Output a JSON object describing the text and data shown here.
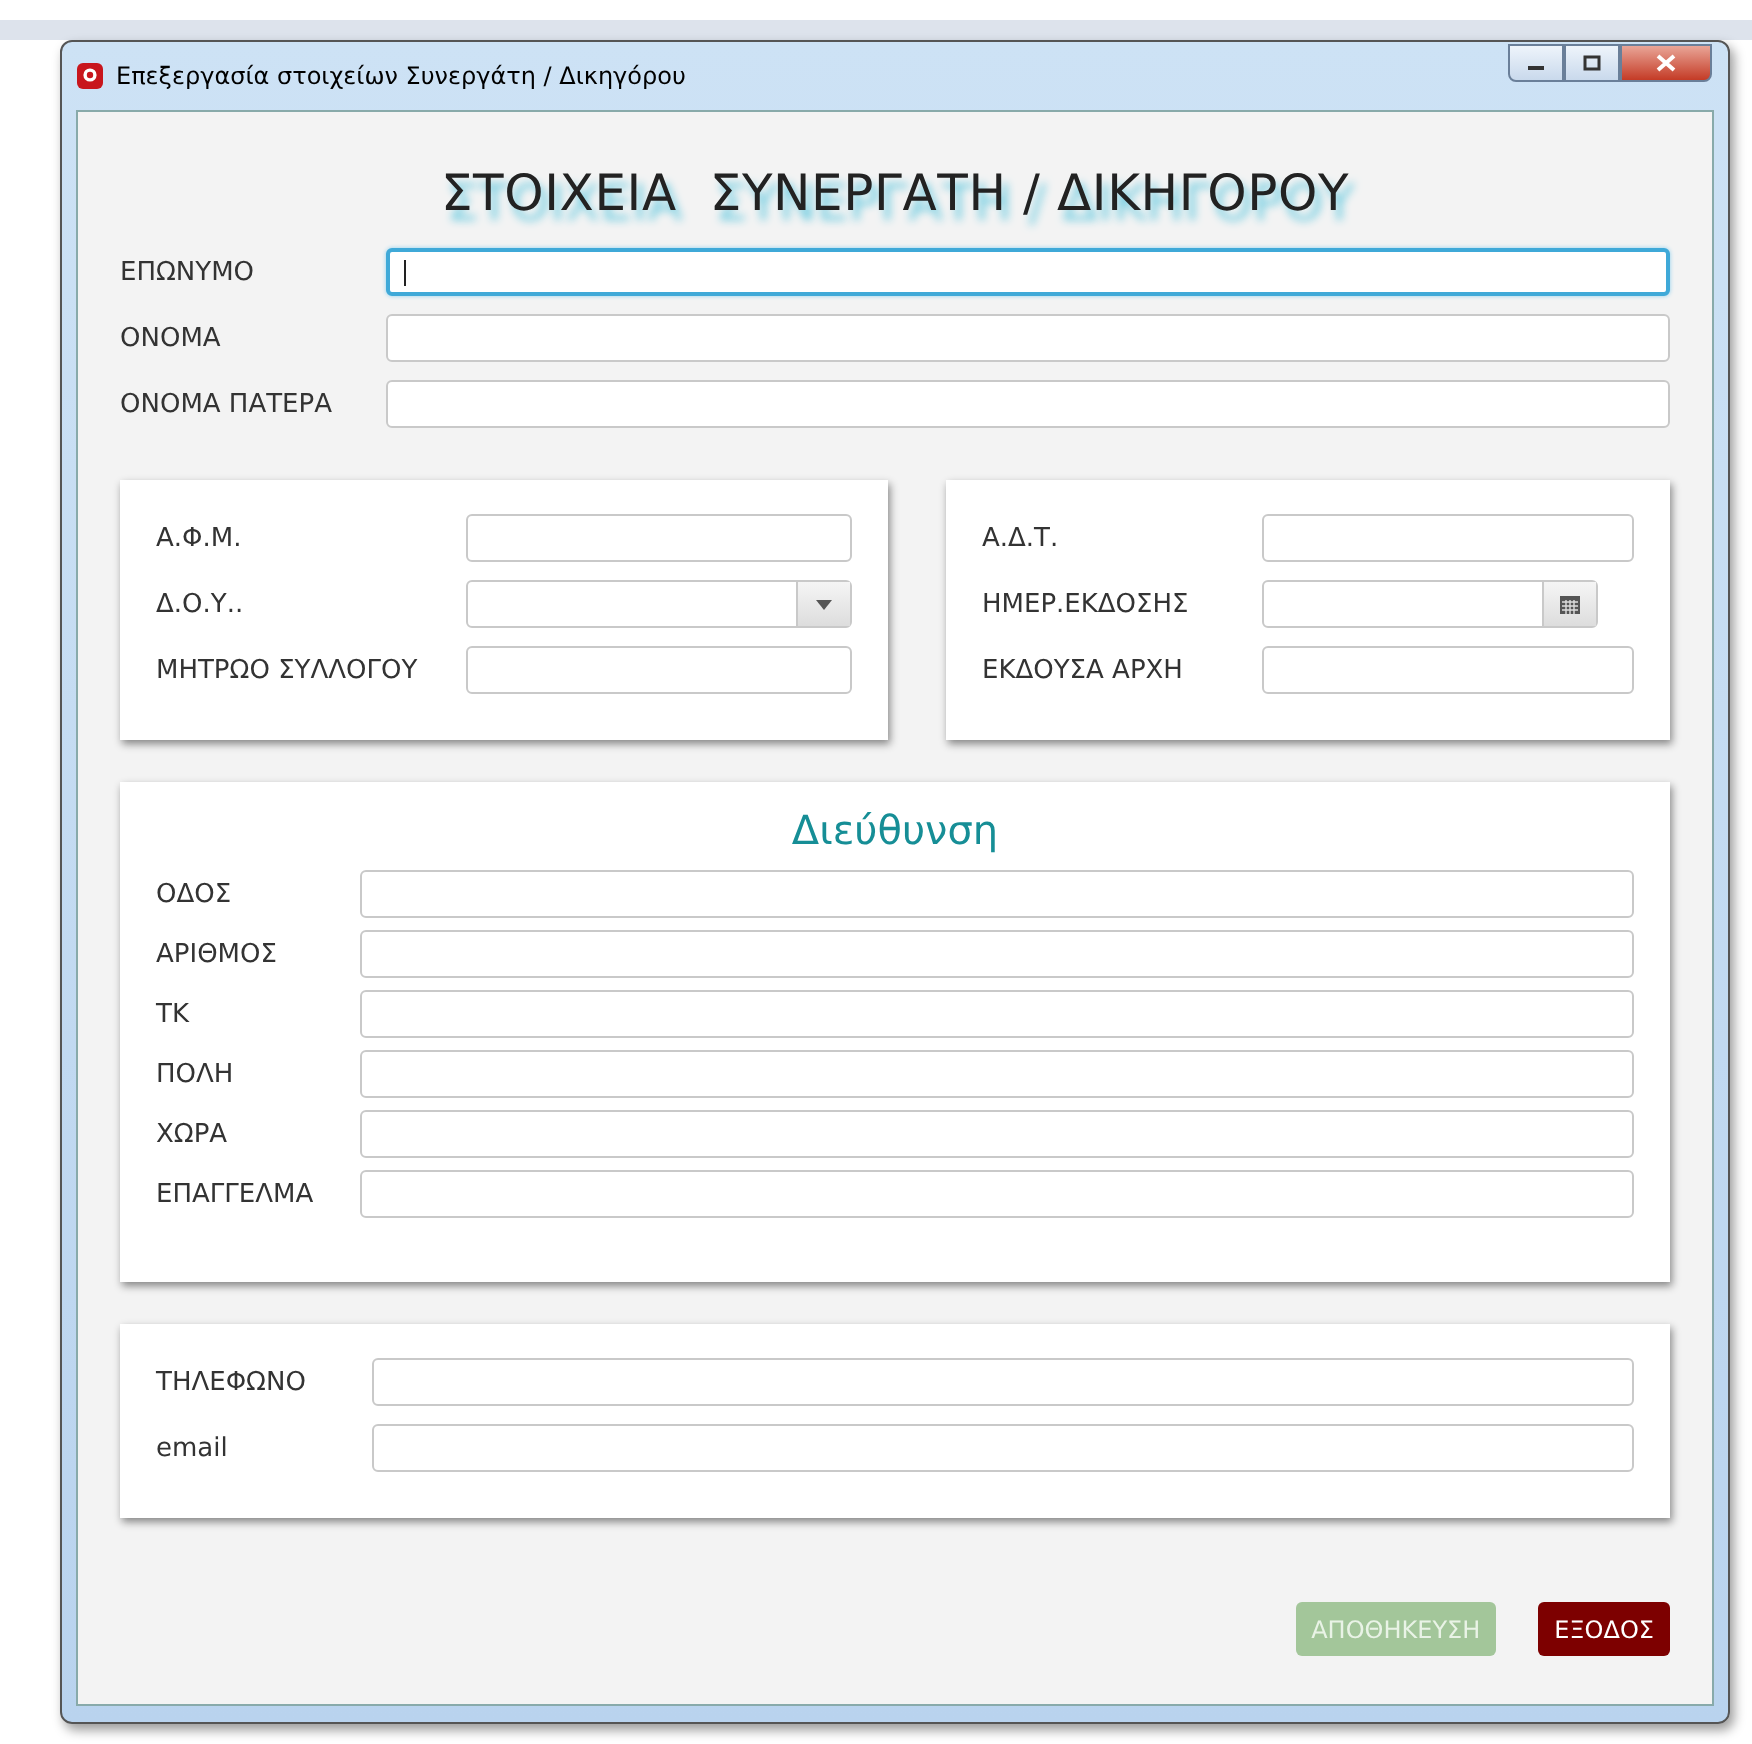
{
  "window": {
    "title": "Επεξεργασία στοιχείων Συνεργάτη / Δικηγόρου"
  },
  "heading": "ΣΤΟΙΧΕΙΑ  ΣΥΝΕΡΓΑΤΗ / ΔΙΚΗΓΟΡΟΥ",
  "name_fields": [
    {
      "label": "ΕΠΩΝΥΜΟ",
      "focused": true
    },
    {
      "label": "ΟΝΟΜΑ",
      "focused": false
    },
    {
      "label": "ΟΝΟΜΑ ΠΑΤΕΡΑ",
      "focused": false
    }
  ],
  "tax_panel": {
    "fields": [
      {
        "label": "Α.Φ.Μ.",
        "kind": "text"
      },
      {
        "label": "Δ.Ο.Υ..",
        "kind": "select"
      },
      {
        "label": "ΜΗΤΡΩΟ ΣΥΛΛΟΓΟΥ",
        "kind": "text"
      }
    ]
  },
  "id_panel": {
    "fields": [
      {
        "label": "Α.Δ.Τ.",
        "kind": "text"
      },
      {
        "label": "ΗΜΕΡ.ΕΚΔΟΣΗΣ",
        "kind": "date"
      },
      {
        "label": "ΕΚΔΟΥΣΑ ΑΡΧΗ",
        "kind": "text"
      }
    ]
  },
  "address_panel": {
    "title": "Διεύθυνση",
    "fields": [
      {
        "label": "ΟΔΟΣ"
      },
      {
        "label": "ΑΡΙΘΜΟΣ"
      },
      {
        "label": "ΤΚ"
      },
      {
        "label": "ΠΟΛΗ"
      },
      {
        "label": "ΧΩΡΑ"
      },
      {
        "label": "ΕΠΑΓΓΕΛΜΑ"
      }
    ]
  },
  "contact_panel": {
    "fields": [
      {
        "label": "ΤΗΛΕΦΩΝΟ"
      },
      {
        "label": "email"
      }
    ]
  },
  "buttons": [
    {
      "label": "ΑΠΟΘΗΚΕΥΣΗ",
      "kind": "save",
      "disabled": true
    },
    {
      "label": "ΕΞΟΔΟΣ",
      "kind": "exit",
      "disabled": false
    }
  ]
}
